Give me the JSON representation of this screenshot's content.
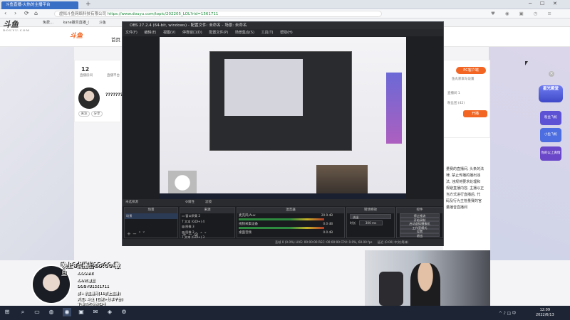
{
  "browser": {
    "tab_title": "斗鱼直播-火热的主播平台",
    "new_tab": "+",
    "url_site": "虚拟斗鱼网络科技有限公司 ",
    "url": "https://www.douyu.com/topic/202205_LOL?rid=1561711",
    "bookmarks": [
      "免费…",
      "kane撒旦直播_(",
      "斗鱼"
    ],
    "window_controls": [
      "─",
      "☐",
      "✕"
    ],
    "nav": [
      "‹",
      "›",
      "⟳",
      "⌂"
    ],
    "right_icons": "♥ ◉ ▣ ◷ ≡"
  },
  "site": {
    "logo": "斗鱼",
    "logo_sub": "DOUYU.COM",
    "brand2": "斗鱼",
    "nav_home": "首页",
    "left_card": {
      "count": "12",
      "count_label": "直播房间",
      "heat_label": "直播平台",
      "anchor_name": "?????????",
      "follow": "关注",
      "share": "分享"
    },
    "right_card": {
      "pc_btn": "PC客户端",
      "line1": "鱼丸获取与设置",
      "line2": "直播间 1",
      "line3": "粉丝团 (42)",
      "stream_btn": "开播"
    },
    "article_lines": [
      "量赛的直播间, 头条的法",
      "律, 禁止传播的播出违",
      "法, 违规将要求处理和",
      "规避直播内容, 主播以正",
      "当方式进行直播后, 代",
      "码及行为主管量赛的官",
      "量播音直播间"
    ],
    "float_badge": "星光殿堂",
    "float_items": [
      "粉丝飞机",
      "小鱼飞机",
      "你的以上真情"
    ]
  },
  "obs": {
    "title": "OBS 27.2.4 (64-bit, windows) - 配置文件: 未命名 - 场景: 未命名",
    "menu": [
      "文件(F)",
      "编辑(E)",
      "视图(V)",
      "停靠窗口(D)",
      "配置文件(P)",
      "场景集合(S)",
      "工具(T)",
      "帮助(H)"
    ],
    "strip_label": "未选择源",
    "strip_props": "⚙属性",
    "strip_filters": "滤镜",
    "scenes_header": "场景",
    "scenes": [
      "场景"
    ],
    "sources_header": "来源",
    "sources": [
      "窗口采集 2",
      "文本 (GDI+) 4",
      "图像 3",
      "图像 2",
      "文本 (GDI+) 3",
      "文本 (GDI+) 2"
    ],
    "mixer_header": "混音器",
    "mixer": [
      {
        "name": "麦克风/Aux",
        "db": "20.9 dB"
      },
      {
        "name": "视频采集设备",
        "db": "0.0 dB"
      },
      {
        "name": "桌面音频",
        "db": "0.0 dB"
      }
    ],
    "transitions_header": "转场特效",
    "transition": "淡出",
    "duration_label": "时长",
    "duration": "300 ms",
    "controls_header": "控件",
    "controls": [
      "停止推流",
      "开始录制",
      "启动虚拟摄像机",
      "工作室模式",
      "设置",
      "退出"
    ],
    "status": "丢帧 0 (0.0%)   LIVE: 00:00:00   REC: 00:00:00   CPU: 0.0%, 60.00 fps",
    "status_right": "延迟 (0.00)   中文(简体)"
  },
  "overlay": {
    "title": "晚上8点播出15:00-撒旦",
    "lines": [
      "KKKANE",
      "KANE撒旦",
      "DOUYU1561711",
      "群+号直播间(11群上直播)",
      "关注: 斗鱼  (右键+分享平台)",
      "下播前可视频扣号"
    ]
  },
  "taskbar": {
    "icons": [
      "⊞",
      "⌕",
      "▭",
      "◍",
      "◉",
      "▣",
      "✉",
      "◈",
      "⚙"
    ],
    "time": "12:09",
    "date": "2022/6/13",
    "tray": "^ ♪ ◫ 中"
  }
}
